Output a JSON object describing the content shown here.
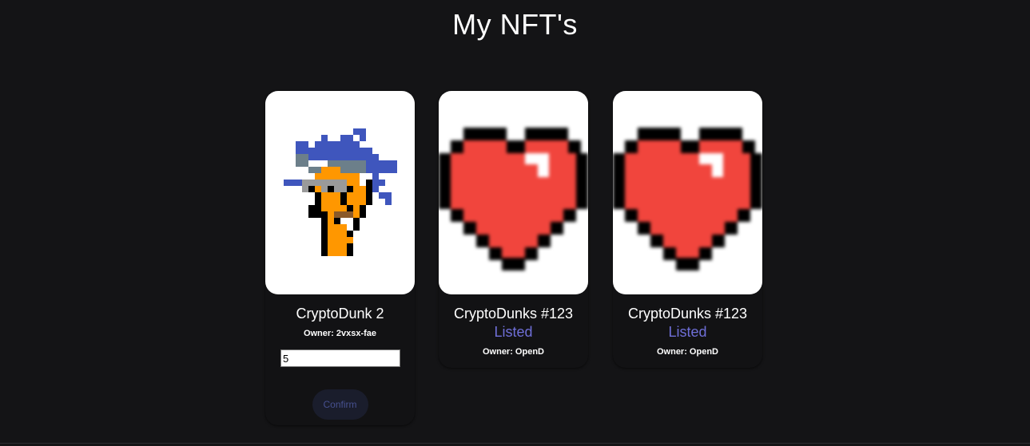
{
  "page": {
    "title": "My NFT's"
  },
  "cards": [
    {
      "name": "CryptoDunk 2",
      "owner": "Owner: 2vxsx-fae",
      "image_icon": "pixel-punk-icon",
      "price_input_value": "5",
      "confirm_label": "Confirm"
    },
    {
      "name": "CryptoDunks #123",
      "status": "Listed",
      "owner": "Owner: OpenD",
      "image_icon": "pixel-heart-icon"
    },
    {
      "name": "CryptoDunks #123",
      "status": "Listed",
      "owner": "Owner: OpenD",
      "image_icon": "pixel-heart-icon"
    }
  ],
  "colors": {
    "background": "#141416",
    "card_background": "#121214",
    "listed_status": "#6f6fd8",
    "confirm_button_bg": "#1a1d2c",
    "confirm_button_text": "#46508f",
    "heart_red": "#f1453d"
  }
}
